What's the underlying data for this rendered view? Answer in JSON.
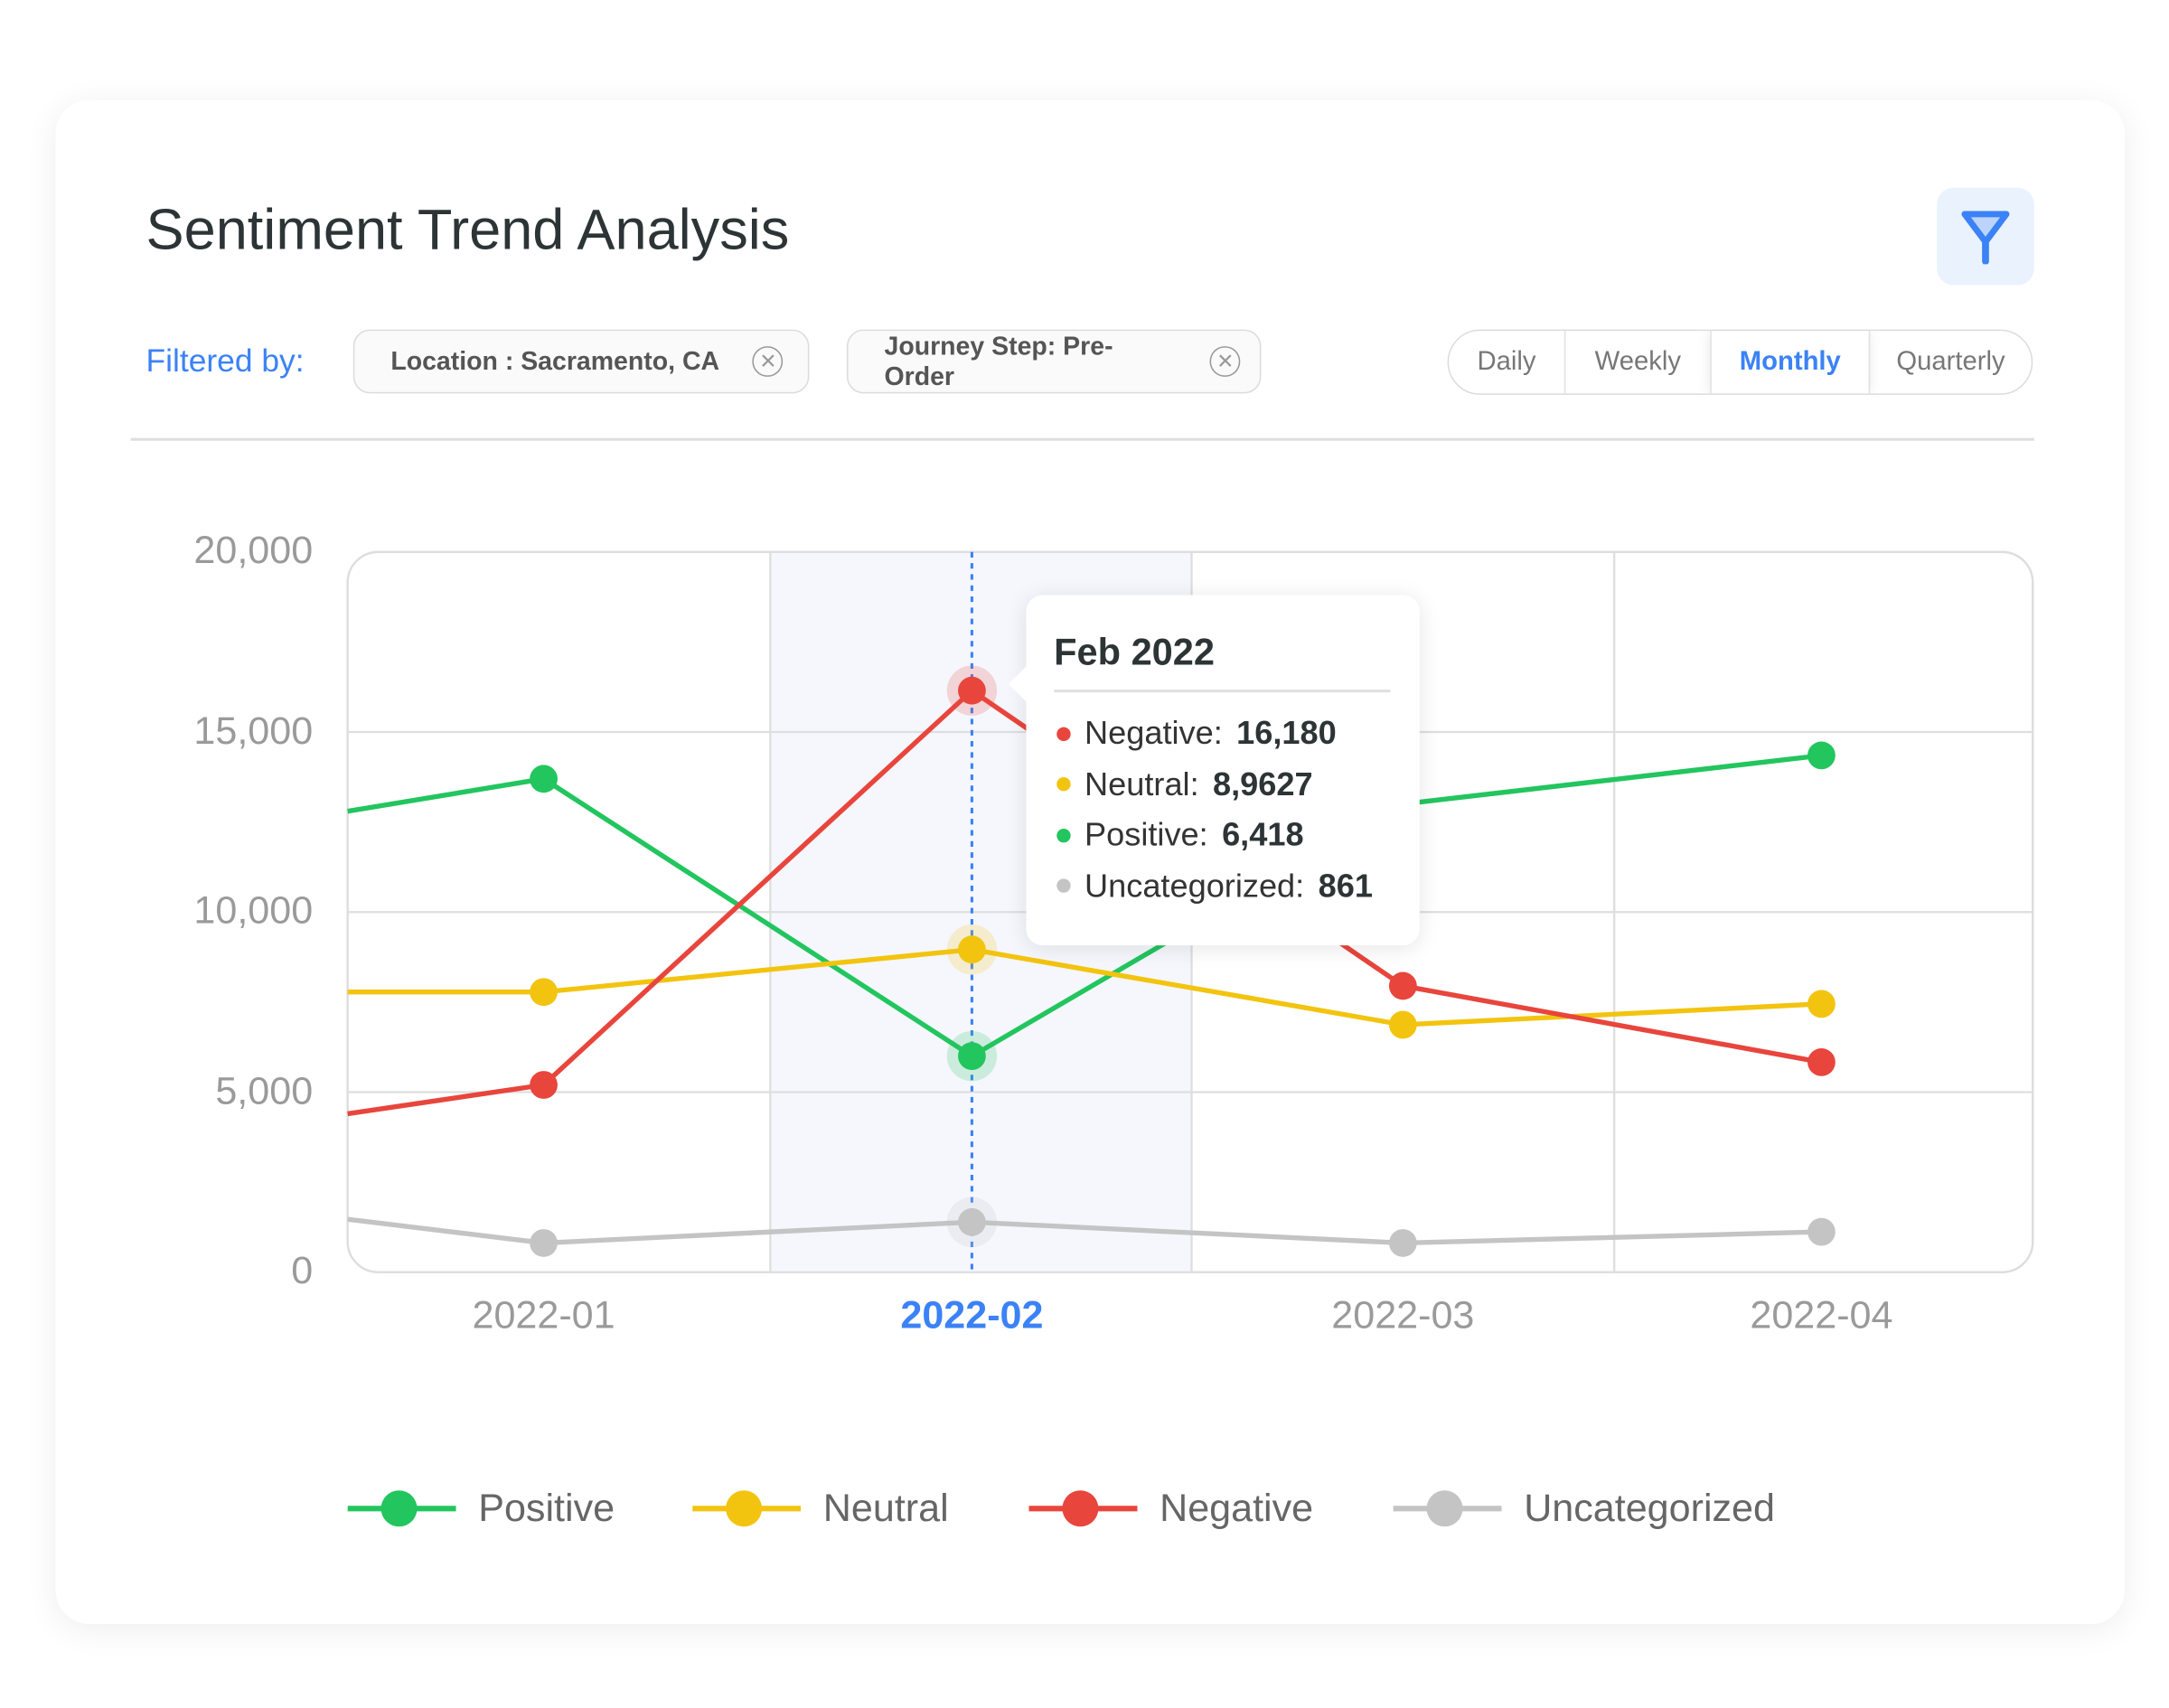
{
  "header": {
    "title": "Sentiment Trend Analysis",
    "filter_button_icon": "filter-icon"
  },
  "filters": {
    "label": "Filtered by:",
    "chips": [
      {
        "label": "Location : Sacramento, CA",
        "remove_icon": "close-circle-icon"
      },
      {
        "label": "Journey Step: Pre-Order",
        "remove_icon": "close-circle-icon"
      }
    ]
  },
  "period": {
    "options": [
      "Daily",
      "Weekly",
      "Monthly",
      "Quarterly"
    ],
    "selected": "Monthly"
  },
  "tooltip": {
    "title": "Feb 2022",
    "rows": [
      {
        "label": "Negative:",
        "value": "16,180",
        "color": "#e8453c"
      },
      {
        "label": "Neutral:",
        "value": "8,9627",
        "color": "#f2c40f"
      },
      {
        "label": "Positive:",
        "value": "6,418",
        "color": "#22c55e"
      },
      {
        "label": "Uncategorized:",
        "value": "861",
        "color": "#c4c4c4"
      }
    ]
  },
  "chart_data": {
    "type": "line",
    "categories": [
      "2022-01",
      "2022-02",
      "2022-03",
      "2022-04"
    ],
    "highlighted_category": "2022-02",
    "ylim": [
      0,
      20000
    ],
    "yticks": [
      "0",
      "5,000",
      "10,000",
      "15,000",
      "20,000"
    ],
    "ytick_values": [
      0,
      5000,
      10000,
      15000,
      20000
    ],
    "grid": true,
    "legend_placement": "bottom",
    "series": [
      {
        "name": "Positive",
        "color": "#22c55e",
        "edge_value": 12800,
        "values": [
          13700,
          6000,
          13000,
          14350
        ]
      },
      {
        "name": "Neutral",
        "color": "#f2c40f",
        "edge_value": 7780,
        "values": [
          7780,
          8960,
          6870,
          7450
        ]
      },
      {
        "name": "Negative",
        "color": "#e8453c",
        "edge_value": 4400,
        "values": [
          5200,
          16150,
          7950,
          5830
        ]
      },
      {
        "name": "Uncategorized",
        "color": "#c4c4c4",
        "edge_value": 1470,
        "values": [
          810,
          1390,
          810,
          1120
        ]
      }
    ]
  }
}
